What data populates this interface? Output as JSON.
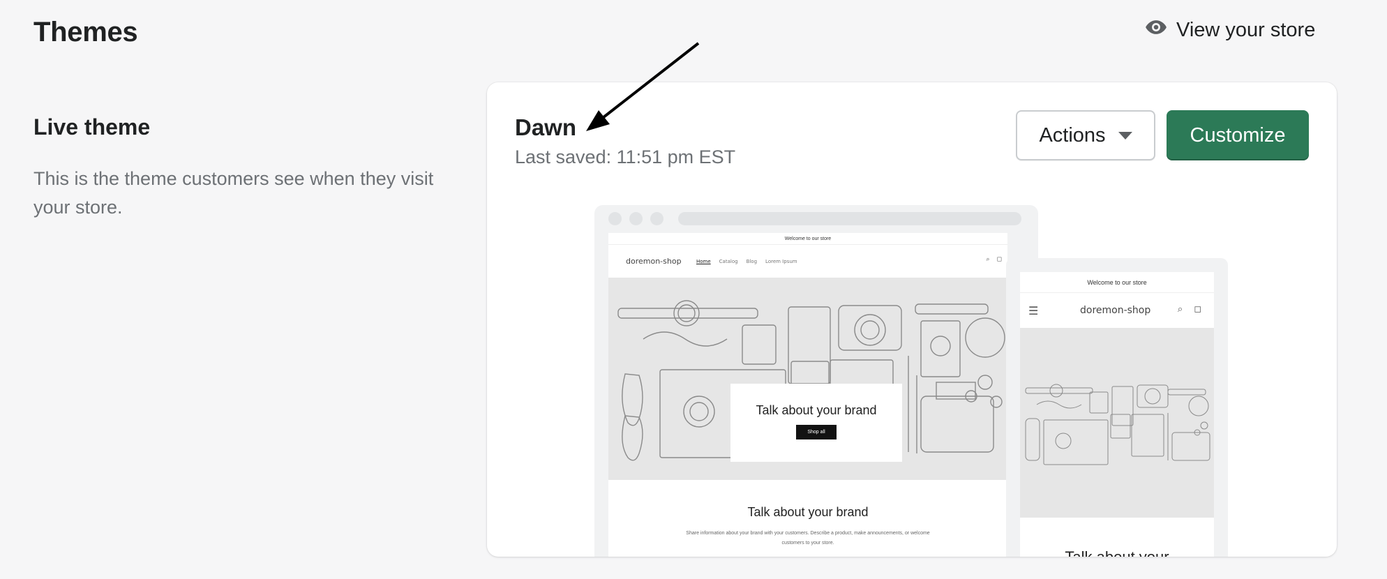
{
  "header": {
    "title": "Themes",
    "view_store_label": "View your store",
    "view_store_icon": "eye-icon"
  },
  "live_section": {
    "title": "Live theme",
    "description": "This is the theme customers see when they visit your store."
  },
  "theme_card": {
    "name": "Dawn",
    "last_saved": "Last saved: 11:51 pm EST",
    "actions_label": "Actions",
    "customize_label": "Customize",
    "accent_color": "#2c7a57"
  },
  "preview": {
    "announcement": "Welcome to our store",
    "shop_name": "doremon-shop",
    "nav": [
      "Home",
      "Catalog",
      "Blog",
      "Lorem Ipsum"
    ],
    "hero_title": "Talk about your brand",
    "hero_button": "Shop all",
    "section_title": "Talk about your brand",
    "section_text": "Share information about your brand with your customers. Describe a product, make announcements, or welcome customers to your store.",
    "mobile_section_title": "Talk about your"
  }
}
